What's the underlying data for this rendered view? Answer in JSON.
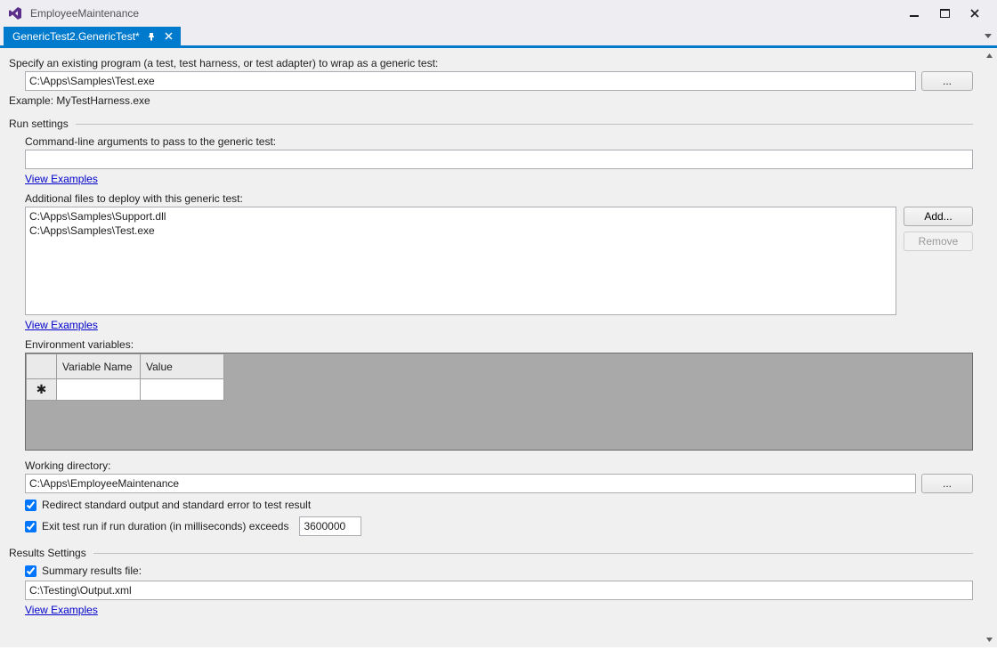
{
  "window": {
    "title": "EmployeeMaintenance"
  },
  "tab": {
    "label": "GenericTest2.GenericTest*"
  },
  "program": {
    "label": "Specify an existing program (a test, test harness, or test adapter) to wrap as a generic test:",
    "value": "C:\\Apps\\Samples\\Test.exe",
    "example": "Example: MyTestHarness.exe",
    "browse": "..."
  },
  "run_settings": {
    "heading": "Run settings",
    "cmdline_label": "Command-line arguments to pass to the generic test:",
    "cmdline_value": "",
    "view_examples": "View Examples",
    "files_label": "Additional files to deploy with this generic test:",
    "files": [
      "C:\\Apps\\Samples\\Support.dll",
      "C:\\Apps\\Samples\\Test.exe"
    ],
    "add": "Add...",
    "remove": "Remove",
    "env_label": "Environment variables:",
    "env_col_name": "Variable Name",
    "env_col_value": "Value",
    "workdir_label": "Working directory:",
    "workdir_value": "C:\\Apps\\EmployeeMaintenance",
    "workdir_browse": "...",
    "redirect_label": "Redirect standard output and standard error to test result",
    "redirect_checked": true,
    "exit_label": "Exit test run if run duration (in milliseconds) exceeds",
    "exit_checked": true,
    "exit_value": "3600000"
  },
  "results": {
    "heading": "Results Settings",
    "summary_label": "Summary results file:",
    "summary_checked": true,
    "summary_value": "C:\\Testing\\Output.xml",
    "view_examples": "View Examples"
  }
}
